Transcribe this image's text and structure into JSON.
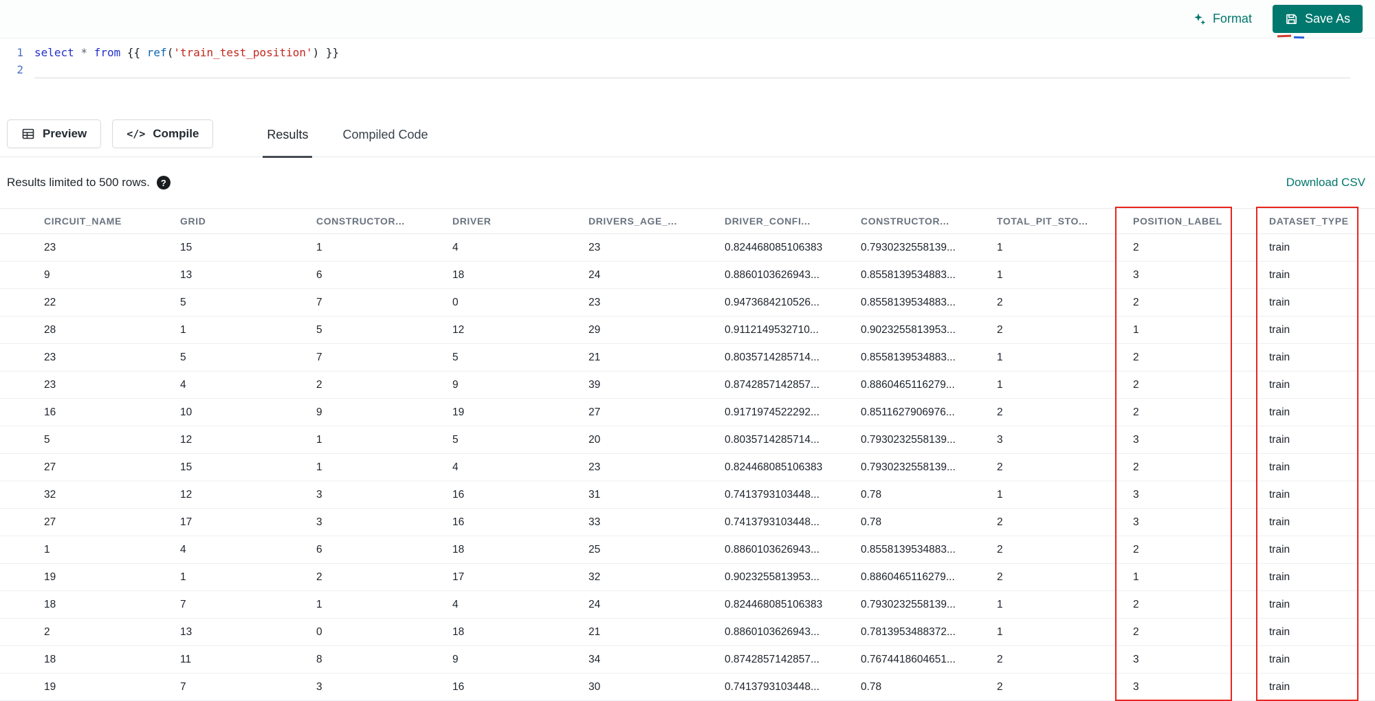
{
  "topbar": {
    "format_label": "Format",
    "save_as_label": "Save As"
  },
  "icons": {
    "format": "sparkles-icon",
    "save_as": "floppy-disk-icon",
    "preview": "table-grid-icon",
    "compile": "code-icon",
    "compile_glyph": "</>",
    "help": "question-mark-icon"
  },
  "editor": {
    "lines": [
      {
        "number": "1",
        "underline": false,
        "tokens": [
          {
            "text": "select",
            "type": "keyword"
          },
          {
            "text": " ",
            "type": "plain"
          },
          {
            "text": "*",
            "type": "operator"
          },
          {
            "text": " ",
            "type": "plain"
          },
          {
            "text": "from",
            "type": "keyword"
          },
          {
            "text": " {{ ",
            "type": "plain"
          },
          {
            "text": "ref",
            "type": "function"
          },
          {
            "text": "(",
            "type": "plain"
          },
          {
            "text": "'train_test_position'",
            "type": "string"
          },
          {
            "text": ")",
            "type": "plain"
          },
          {
            "text": " }}",
            "type": "plain"
          }
        ]
      },
      {
        "number": "2",
        "underline": true,
        "tokens": []
      }
    ]
  },
  "toolbar": {
    "preview_label": "Preview",
    "compile_label": "Compile",
    "tabs": [
      {
        "label": "Results",
        "active": true
      },
      {
        "label": "Compiled Code",
        "active": false
      }
    ]
  },
  "results": {
    "limit_text": "Results limited to 500 rows.",
    "download_label": "Download CSV",
    "highlight_color": "#e8241c",
    "highlighted_columns": [
      "POSITION_LABEL",
      "DATASET_TYPE"
    ],
    "columns": [
      "CIRCUIT_NAME",
      "GRID",
      "CONSTRUCTOR...",
      "DRIVER",
      "DRIVERS_AGE_...",
      "DRIVER_CONFI...",
      "CONSTRUCTOR...",
      "TOTAL_PIT_STO...",
      "POSITION_LABEL",
      "DATASET_TYPE"
    ],
    "rows": [
      [
        "23",
        "15",
        "1",
        "4",
        "23",
        "0.824468085106383",
        "0.7930232558139...",
        "1",
        "2",
        "train"
      ],
      [
        "9",
        "13",
        "6",
        "18",
        "24",
        "0.8860103626943...",
        "0.8558139534883...",
        "1",
        "3",
        "train"
      ],
      [
        "22",
        "5",
        "7",
        "0",
        "23",
        "0.9473684210526...",
        "0.8558139534883...",
        "2",
        "2",
        "train"
      ],
      [
        "28",
        "1",
        "5",
        "12",
        "29",
        "0.9112149532710...",
        "0.9023255813953...",
        "2",
        "1",
        "train"
      ],
      [
        "23",
        "5",
        "7",
        "5",
        "21",
        "0.8035714285714...",
        "0.8558139534883...",
        "1",
        "2",
        "train"
      ],
      [
        "23",
        "4",
        "2",
        "9",
        "39",
        "0.8742857142857...",
        "0.8860465116279...",
        "1",
        "2",
        "train"
      ],
      [
        "16",
        "10",
        "9",
        "19",
        "27",
        "0.9171974522292...",
        "0.8511627906976...",
        "2",
        "2",
        "train"
      ],
      [
        "5",
        "12",
        "1",
        "5",
        "20",
        "0.8035714285714...",
        "0.7930232558139...",
        "3",
        "3",
        "train"
      ],
      [
        "27",
        "15",
        "1",
        "4",
        "23",
        "0.824468085106383",
        "0.7930232558139...",
        "2",
        "2",
        "train"
      ],
      [
        "32",
        "12",
        "3",
        "16",
        "31",
        "0.7413793103448...",
        "0.78",
        "1",
        "3",
        "train"
      ],
      [
        "27",
        "17",
        "3",
        "16",
        "33",
        "0.7413793103448...",
        "0.78",
        "2",
        "3",
        "train"
      ],
      [
        "1",
        "4",
        "6",
        "18",
        "25",
        "0.8860103626943...",
        "0.8558139534883...",
        "2",
        "2",
        "train"
      ],
      [
        "19",
        "1",
        "2",
        "17",
        "32",
        "0.9023255813953...",
        "0.8860465116279...",
        "2",
        "1",
        "train"
      ],
      [
        "18",
        "7",
        "1",
        "4",
        "24",
        "0.824468085106383",
        "0.7930232558139...",
        "1",
        "2",
        "train"
      ],
      [
        "2",
        "13",
        "0",
        "18",
        "21",
        "0.8860103626943...",
        "0.7813953488372...",
        "1",
        "2",
        "train"
      ],
      [
        "18",
        "11",
        "8",
        "9",
        "34",
        "0.8742857142857...",
        "0.7674418604651...",
        "2",
        "3",
        "train"
      ],
      [
        "19",
        "7",
        "3",
        "16",
        "30",
        "0.7413793103448...",
        "0.78",
        "2",
        "3",
        "train"
      ]
    ]
  }
}
